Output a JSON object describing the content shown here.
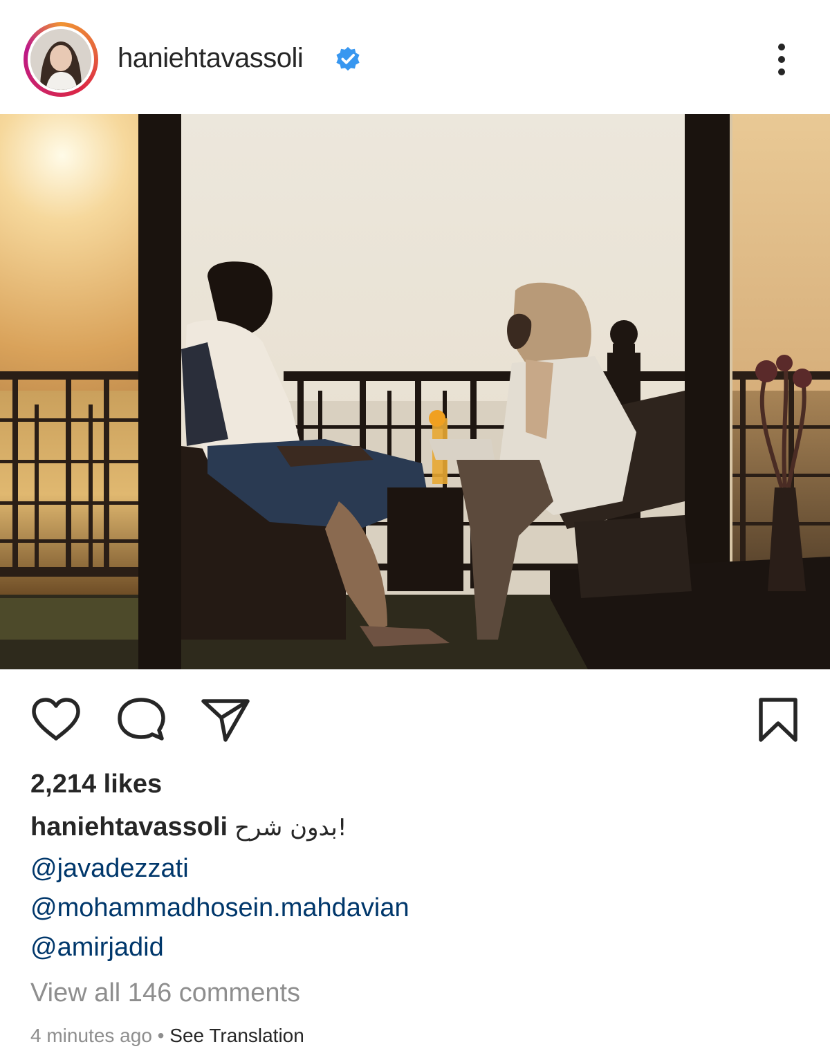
{
  "post": {
    "username": "haniehtavassoli",
    "verified": true,
    "likes": "2,214 likes",
    "caption_user": "haniehtavassoli",
    "caption_text": "!بدون شرح",
    "mentions": [
      "@javadezzati",
      "@mohammadhosein.mahdavian",
      "@amirjadid"
    ],
    "view_comments": "View all 146 comments",
    "time_ago": "4 minutes ago",
    "separator": "•",
    "see_translation": "See Translation"
  },
  "icons": {
    "verified": "verified-badge-icon",
    "more": "more-options-icon",
    "like": "heart-icon",
    "comment": "comment-icon",
    "share": "share-icon",
    "save": "bookmark-icon"
  },
  "colors": {
    "verified_blue": "#3897f0",
    "mention_blue": "#00376b",
    "muted_gray": "#8e8e8e",
    "text": "#262626"
  }
}
